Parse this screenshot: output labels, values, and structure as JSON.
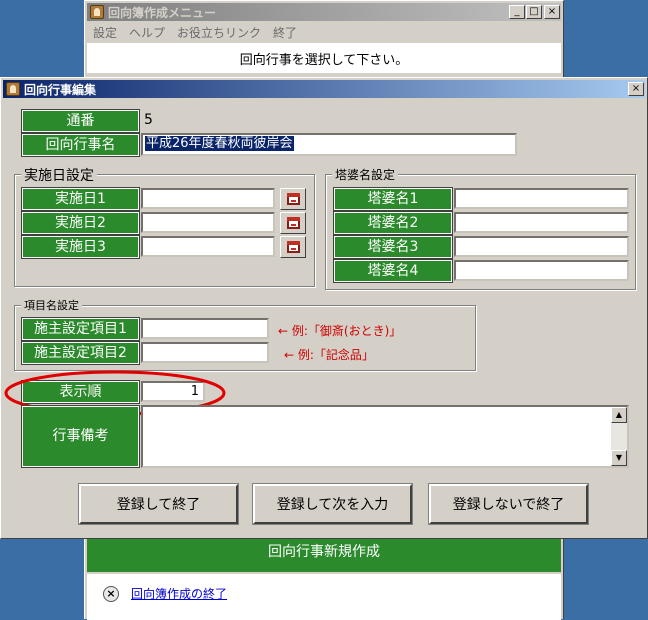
{
  "background_window": {
    "title": "回向簿作成メニュー",
    "caption_buttons": {
      "minimize": "_",
      "maximize": "□",
      "close": "×"
    },
    "menu": [
      "設定",
      "ヘルプ",
      "お役立ちリンク",
      "終了"
    ],
    "instruction": "回向行事を選択して下さい。",
    "new_event_button": "回向行事新規作成",
    "exit_icon": "×",
    "exit_link": "回向簿作成の終了"
  },
  "dialog": {
    "title": "回向行事編集",
    "close_button": "×",
    "serial_label": "通番",
    "serial_value": "5",
    "event_name_label": "回向行事名",
    "event_name_value": "平成26年度春秋両彼岸会",
    "dates_group": {
      "title": "実施日設定",
      "rows": [
        {
          "label": "実施日1",
          "value": ""
        },
        {
          "label": "実施日2",
          "value": ""
        },
        {
          "label": "実施日3",
          "value": ""
        }
      ]
    },
    "stupa_group": {
      "title": "塔婆名設定",
      "rows": [
        {
          "label": "塔婆名1",
          "value": ""
        },
        {
          "label": "塔婆名2",
          "value": ""
        },
        {
          "label": "塔婆名3",
          "value": ""
        },
        {
          "label": "塔婆名4",
          "value": ""
        }
      ]
    },
    "items_group": {
      "title": "項目名設定",
      "rows": [
        {
          "label": "施主設定項目1",
          "value": "",
          "hint": "← 例:「御斎(おとき)」"
        },
        {
          "label": "施主設定項目2",
          "value": "",
          "hint": "← 例:「記念品」"
        }
      ]
    },
    "display_order_label": "表示順",
    "display_order_value": "1",
    "notes_label": "行事備考",
    "notes_value": "",
    "buttons": {
      "register_exit": "登録して終了",
      "register_next": "登録して次を入力",
      "exit_no_register": "登録しないで終了"
    },
    "highlight_color": "#e00000",
    "accent_green": "#2b8a2b"
  }
}
